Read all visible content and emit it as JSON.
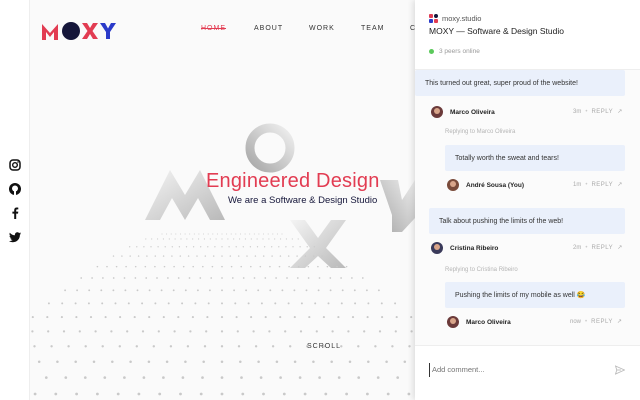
{
  "site": {
    "nav": [
      {
        "label": "HOME",
        "active": true
      },
      {
        "label": "ABOUT"
      },
      {
        "label": "WORK"
      },
      {
        "label": "TEAM"
      },
      {
        "label": "C"
      }
    ],
    "hero_title": "Engineered Design",
    "hero_subtitle": "We are a Software & Design Studio",
    "scroll_label": "SCROLL",
    "social_icons": [
      "instagram-icon",
      "github-icon",
      "facebook-icon",
      "twitter-icon"
    ],
    "accent_color": "#e23c52",
    "navy_color": "#15163a"
  },
  "panel": {
    "site_url": "moxy.studio",
    "site_title": "MOXY — Software & Design Studio",
    "peers_online": "3 peers online",
    "comments": [
      {
        "text": "This turned out great, super proud of the website!",
        "author": "Marco Oliveira",
        "time": "3m",
        "action": "REPLY"
      },
      {
        "replying_to": "Replying to Marco Oliveira",
        "text": "Totally worth the sweat and tears!",
        "author": "André Sousa (You)",
        "time": "1m",
        "action": "REPLY"
      },
      {
        "text": "Talk about pushing the limits of the web!",
        "author": "Cristina Ribeiro",
        "time": "2m",
        "action": "REPLY"
      },
      {
        "replying_to": "Replying to Cristina Ribeiro",
        "text": "Pushing the limits of my mobile as well 😂",
        "author": "Marco Oliveira",
        "time": "now",
        "action": "REPLY"
      }
    ],
    "composer_placeholder": "Add comment..."
  }
}
